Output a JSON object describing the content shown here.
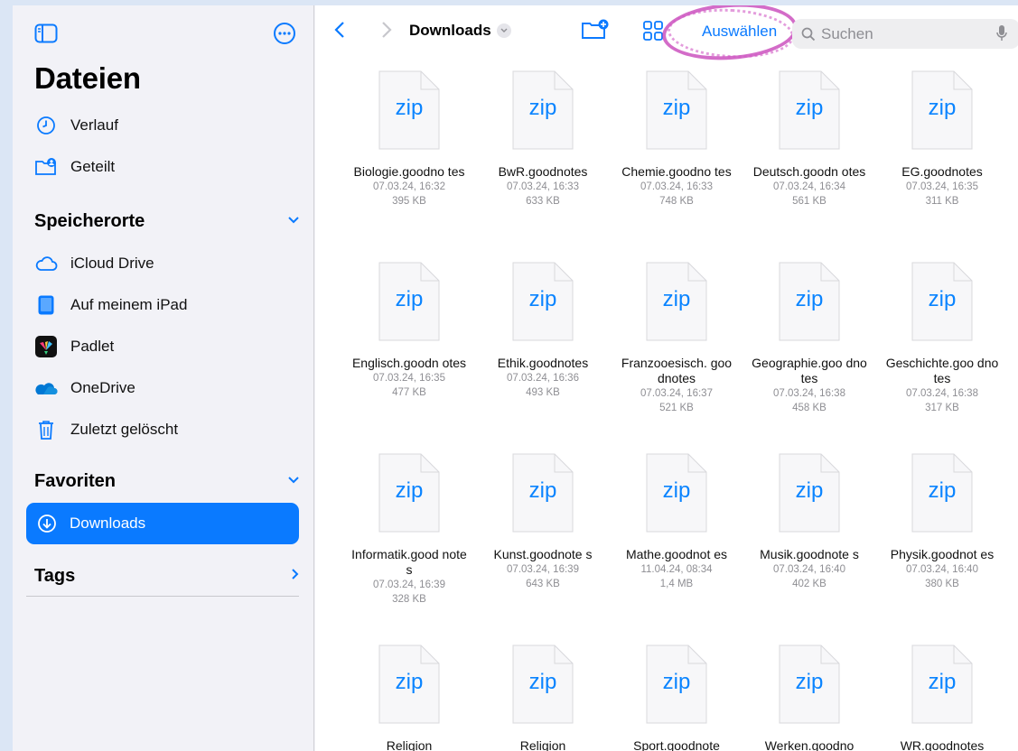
{
  "sidebar": {
    "title": "Dateien",
    "top_items": [
      {
        "label": "Verlauf",
        "icon": "clock-icon"
      },
      {
        "label": "Geteilt",
        "icon": "shared-folder-icon"
      }
    ],
    "locations_header": "Speicherorte",
    "locations": [
      {
        "label": "iCloud Drive",
        "icon": "icloud-icon"
      },
      {
        "label": "Auf meinem iPad",
        "icon": "ipad-icon"
      },
      {
        "label": "Padlet",
        "icon": "padlet-icon"
      },
      {
        "label": "OneDrive",
        "icon": "onedrive-icon"
      },
      {
        "label": "Zuletzt gelöscht",
        "icon": "trash-icon"
      }
    ],
    "favorites_header": "Favoriten",
    "favorites": [
      {
        "label": "Downloads",
        "icon": "download-icon",
        "active": true
      }
    ],
    "tags_header": "Tags"
  },
  "toolbar": {
    "title": "Downloads",
    "select_label": "Auswählen",
    "search_placeholder": "Suchen"
  },
  "files": [
    {
      "name": "Biologie.goodno tes",
      "ext": "zip",
      "date": "07.03.24, 16:32",
      "size": "395 KB"
    },
    {
      "name": "BwR.goodnotes",
      "ext": "zip",
      "date": "07.03.24, 16:33",
      "size": "633 KB"
    },
    {
      "name": "Chemie.goodno tes",
      "ext": "zip",
      "date": "07.03.24, 16:33",
      "size": "748 KB"
    },
    {
      "name": "Deutsch.goodn otes",
      "ext": "zip",
      "date": "07.03.24, 16:34",
      "size": "561 KB"
    },
    {
      "name": "EG.goodnotes",
      "ext": "zip",
      "date": "07.03.24, 16:35",
      "size": "311 KB"
    },
    {
      "name": "Englisch.goodn otes",
      "ext": "zip",
      "date": "07.03.24, 16:35",
      "size": "477 KB"
    },
    {
      "name": "Ethik.goodnotes",
      "ext": "zip",
      "date": "07.03.24, 16:36",
      "size": "493 KB"
    },
    {
      "name": "Franzooesisch. goodnotes",
      "ext": "zip",
      "date": "07.03.24, 16:37",
      "size": "521 KB"
    },
    {
      "name": "Geographie.goo dnotes",
      "ext": "zip",
      "date": "07.03.24, 16:38",
      "size": "458 KB"
    },
    {
      "name": "Geschichte.goo dnotes",
      "ext": "zip",
      "date": "07.03.24, 16:38",
      "size": "317 KB"
    },
    {
      "name": "Informatik.good notes",
      "ext": "zip",
      "date": "07.03.24, 16:39",
      "size": "328 KB"
    },
    {
      "name": "Kunst.goodnote s",
      "ext": "zip",
      "date": "07.03.24, 16:39",
      "size": "643 KB"
    },
    {
      "name": "Mathe.goodnot es",
      "ext": "zip",
      "date": "11.04.24, 08:34",
      "size": "1,4 MB"
    },
    {
      "name": "Musik.goodnote s",
      "ext": "zip",
      "date": "07.03.24, 16:40",
      "size": "402 KB"
    },
    {
      "name": "Physik.goodnot es",
      "ext": "zip",
      "date": "07.03.24, 16:40",
      "size": "380 KB"
    },
    {
      "name": "Religion",
      "ext": "zip",
      "date": "",
      "size": ""
    },
    {
      "name": "Religion",
      "ext": "zip",
      "date": "",
      "size": ""
    },
    {
      "name": "Sport.goodnote",
      "ext": "zip",
      "date": "",
      "size": ""
    },
    {
      "name": "Werken.goodno",
      "ext": "zip",
      "date": "",
      "size": ""
    },
    {
      "name": "WR.goodnotes",
      "ext": "zip",
      "date": "",
      "size": ""
    }
  ],
  "colors": {
    "accent": "#0a7aff",
    "annotation": "#c43bb5"
  }
}
